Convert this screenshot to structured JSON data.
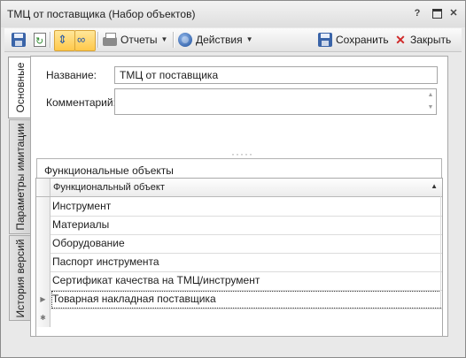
{
  "window": {
    "title": "ТМЦ от поставщика (Набор объектов)",
    "help_glyph": "?",
    "close_glyph": "✕"
  },
  "toolbar": {
    "reports_label": "Отчеты",
    "actions_label": "Действия",
    "save_label": "Сохранить",
    "close_label": "Закрыть"
  },
  "tabs": [
    {
      "label": "Основные",
      "active": true
    },
    {
      "label": "Параметры имитации",
      "active": false
    },
    {
      "label": "История версий",
      "active": false
    }
  ],
  "form": {
    "name_label": "Название:",
    "name_value": "ТМЦ от поставщика",
    "comment_label": "Комментарий:",
    "comment_value": ""
  },
  "group": {
    "title": "Функциональные объекты"
  },
  "grid": {
    "column_header": "Функциональный объект",
    "sort": "ascending",
    "rows": [
      "Инструмент",
      "Материалы",
      "Оборудование",
      "Паспорт инструмента",
      "Сертификат качества на ТМЦ/инструмент",
      "Товарная накладная поставщика"
    ],
    "focused_row": 5,
    "new_row_glyph": "✱",
    "current_row_glyph": "▶"
  },
  "icons": {
    "save": "floppy-icon",
    "refresh": "refresh-icon",
    "reports": "printer-icon",
    "actions": "actions-icon",
    "close": "close-icon"
  },
  "colors": {
    "highlight_toggle": "#ffc84a",
    "close_icon": "#d02a2a",
    "save_icon": "#3a64a8"
  }
}
